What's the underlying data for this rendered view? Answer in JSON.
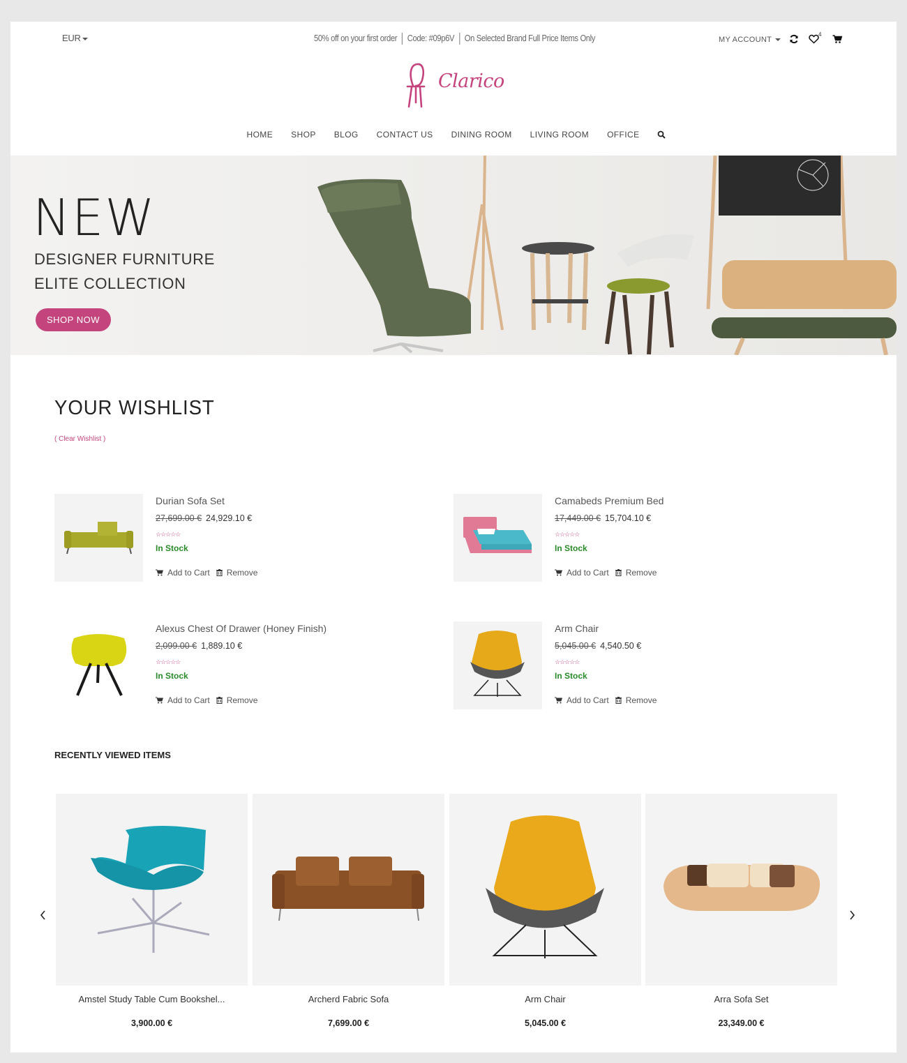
{
  "header": {
    "currency": "EUR",
    "promo": [
      "50% off on your first order",
      "Code: #09p6V",
      "On Selected Brand Full Price Items Only"
    ],
    "account_label": "MY ACCOUNT",
    "wishlist_count": "4",
    "logo_text": "Clarico"
  },
  "nav": [
    "HOME",
    "SHOP",
    "BLOG",
    "CONTACT US",
    "DINING ROOM",
    "LIVING ROOM",
    "OFFICE"
  ],
  "hero": {
    "headline": "NEW",
    "line1": "DESIGNER FURNITURE",
    "line2": "ELITE COLLECTION",
    "button": "SHOP NOW"
  },
  "wishlist": {
    "title": "YOUR WISHLIST",
    "clear_label": "( Clear Wishlist )",
    "add_to_cart": "Add to Cart",
    "remove": "Remove",
    "items": [
      {
        "name": "Durian Sofa Set",
        "old_price": "27,699.00 €",
        "price": "24,929.10 €",
        "stock": "In Stock",
        "image": "green sofa"
      },
      {
        "name": "Camabeds Premium Bed",
        "old_price": "17,449.00 €",
        "price": "15,704.10 €",
        "stock": "In Stock",
        "image": "pink bed"
      },
      {
        "name": "Alexus Chest Of Drawer (Honey Finish)",
        "old_price": "2,099.00 €",
        "price": "1,889.10 €",
        "stock": "In Stock",
        "image": "yellow chair"
      },
      {
        "name": "Arm Chair",
        "old_price": "5,045.00 €",
        "price": "4,540.50 €",
        "stock": "In Stock",
        "image": "mustard arm chair"
      }
    ]
  },
  "recently_viewed": {
    "title": "RECENTLY VIEWED ITEMS",
    "items": [
      {
        "name": "Amstel Study Table Cum Bookshel...",
        "price": "3,900.00 €"
      },
      {
        "name": "Archerd Fabric Sofa",
        "price": "7,699.00 €"
      },
      {
        "name": "Arm Chair",
        "price": "5,045.00 €"
      },
      {
        "name": "Arra Sofa Set",
        "price": "23,349.00 €"
      }
    ]
  },
  "colors": {
    "accent": "#c4457d",
    "stock": "#2a8a2a"
  }
}
